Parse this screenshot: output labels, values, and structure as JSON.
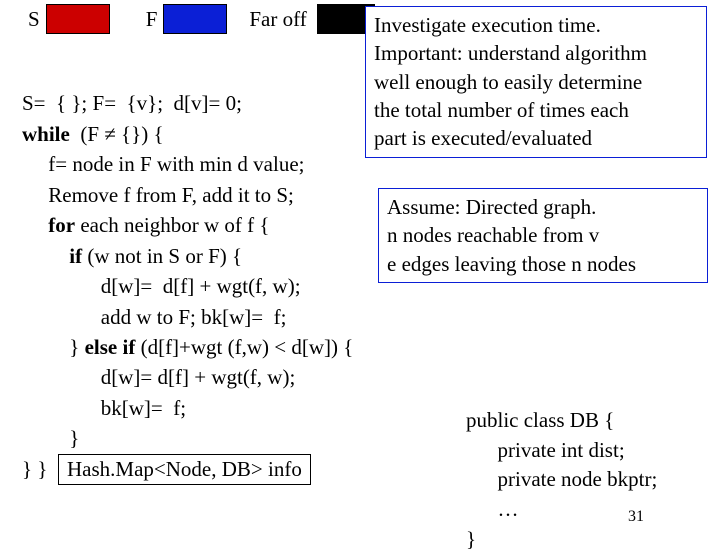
{
  "legend": {
    "s_label": "S",
    "f_label": "F",
    "far_label": "Far off"
  },
  "algo": {
    "l01": "S=  { }; F=  {v};  d[v]= 0;",
    "l02a": "while",
    "l02b": "  (F ≠ {}) {",
    "l03": "     f= node in F with min d value;",
    "l04": "     Remove f from F, add it to S;",
    "l05a": "     for",
    "l05b": " each neighbor w of f {",
    "l06a": "         if",
    "l06b": " (w not in S or F) {",
    "l07": "               d[w]=  d[f] + wgt(f, w);",
    "l08": "               add w to F; bk[w]=  f;",
    "l09a": "         } ",
    "l09b": "else if",
    "l09c": " (d[f]+wgt (f,w) < d[w]) {",
    "l10": "               d[w]= d[f] + wgt(f, w);",
    "l11": "               bk[w]=  f;",
    "l12": "         }",
    "l13": "} }"
  },
  "box1": {
    "t1": "Investigate execution time.",
    "t2": "Important: understand algorithm",
    "t3": "well enough to easily determine",
    "t4": "the total number of times each",
    "t5": "part is executed/evaluated"
  },
  "box2": {
    "t1": "Assume: Directed graph.",
    "t2": "n nodes reachable from v",
    "t3": "e edges leaving those n nodes"
  },
  "cls": {
    "l1": "public class DB {",
    "l2": "      private int dist;",
    "l3": "      private node bkptr;",
    "l4": "      …",
    "l5": "}"
  },
  "info": "Hash.Map<Node, DB> info",
  "pagenum": "31"
}
